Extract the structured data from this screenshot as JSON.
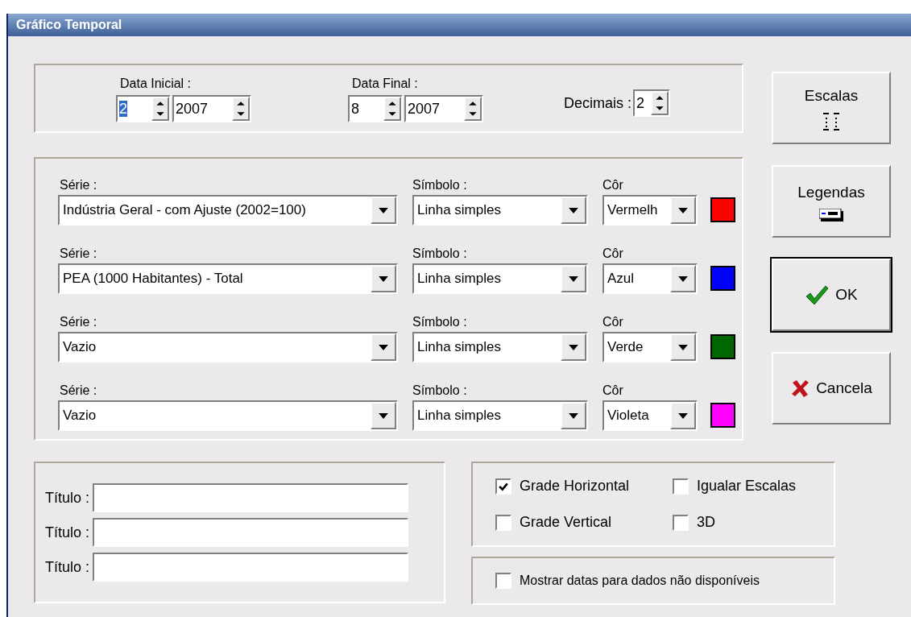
{
  "window": {
    "title": "Gráfico Temporal"
  },
  "dates": [
    {
      "label": "Data Inicial :",
      "month": "2",
      "month_selected": true,
      "year": "2007"
    },
    {
      "label": "Data Final :",
      "month": "8",
      "month_selected": false,
      "year": "2007"
    }
  ],
  "decimals": {
    "label": "Decimais :",
    "value": "2"
  },
  "series": [
    {
      "series_label": "Série :",
      "series_value": "Indústria Geral - com Ajuste (2002=100)",
      "symbol_label": "Símbolo :",
      "symbol_value": "Linha simples",
      "color_label": "Côr",
      "color_value": "Vermelh",
      "color": "#ff0000"
    },
    {
      "series_label": "Série :",
      "series_value": "PEA (1000 Habitantes) - Total",
      "symbol_label": "Símbolo :",
      "symbol_value": "Linha simples",
      "color_label": "Côr",
      "color_value": "Azul",
      "color": "#0000ff"
    },
    {
      "series_label": "Série :",
      "series_value": "Vazio",
      "symbol_label": "Símbolo :",
      "symbol_value": "Linha simples",
      "color_label": "Côr",
      "color_value": "Verde",
      "color": "#006600"
    },
    {
      "series_label": "Série :",
      "series_value": "Vazio",
      "symbol_label": "Símbolo :",
      "symbol_value": "Linha simples",
      "color_label": "Côr",
      "color_value": "Violeta",
      "color": "#ff00ff"
    }
  ],
  "buttons": [
    {
      "kind": "scales",
      "label": "Escalas"
    },
    {
      "kind": "legends",
      "label": "Legendas"
    },
    {
      "kind": "ok",
      "label": "OK",
      "default": true
    },
    {
      "kind": "cancel",
      "label": "Cancela",
      "default": false
    }
  ],
  "titles": [
    {
      "label": "Título :"
    },
    {
      "label": "Título :"
    },
    {
      "label": "Título :"
    }
  ],
  "grid_options": [
    {
      "label": "Grade Horizontal",
      "checked": true
    },
    {
      "label": "Igualar Escalas",
      "checked": false
    },
    {
      "label": "Grade Vertical",
      "checked": false
    },
    {
      "label": "3D",
      "checked": false
    }
  ],
  "show_missing": {
    "label": "Mostrar datas para dados não disponíveis",
    "checked": false
  }
}
